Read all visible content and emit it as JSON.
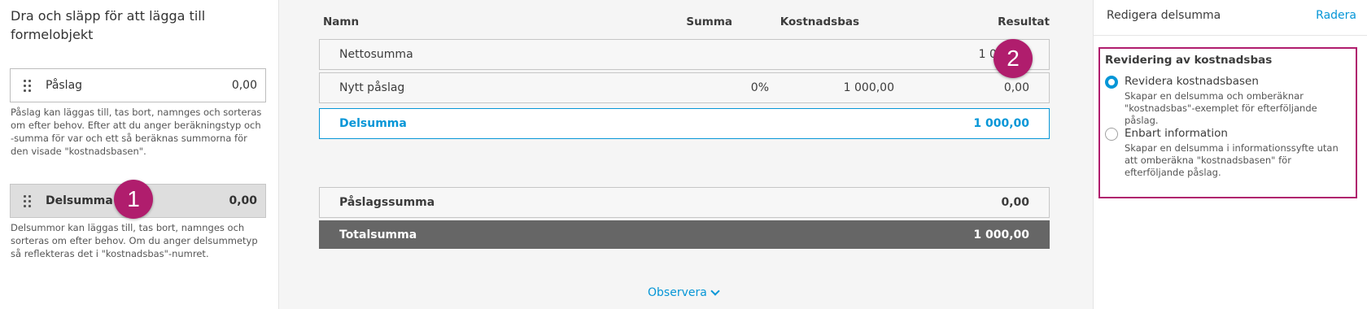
{
  "palette": {
    "title": "Dra och släpp för att lägga till formelobjekt",
    "items": [
      {
        "label": "Påslag",
        "value": "0,00",
        "help": "Påslag kan läggas till, tas bort, namnges och sorteras om efter behov. Efter att du anger beräkningstyp och -summa för var och ett så beräknas summorna för den visade \"kostnadsbasen\"."
      },
      {
        "label": "Delsumma",
        "value": "0,00",
        "help": "Delsummor kan läggas till, tas bort, namnges och sorteras om efter behov. Om du anger delsummetyp så reflekteras det i \"kostnadsbas\"-numret."
      }
    ]
  },
  "badges": {
    "one": "1",
    "two": "2"
  },
  "table": {
    "headers": {
      "name": "Namn",
      "sum": "Summa",
      "base": "Kostnadsbas",
      "result": "Resultat"
    },
    "rows": [
      {
        "name": "Nettosumma",
        "sum": "",
        "base": "",
        "result": "1 000,00"
      },
      {
        "name": "Nytt påslag",
        "sum": "0%",
        "base": "1 000,00",
        "result": "0,00"
      },
      {
        "name": "Delsumma",
        "sum": "",
        "base": "",
        "result": "1 000,00"
      }
    ],
    "markup_total": {
      "name": "Påslagssumma",
      "result": "0,00"
    },
    "grand_total": {
      "name": "Totalsumma",
      "result": "1 000,00"
    },
    "observe_label": "Observera"
  },
  "panel": {
    "title": "Redigera delsumma",
    "delete_label": "Radera",
    "section_title": "Revidering av kostnadsbas",
    "options": [
      {
        "label": "Revidera kostnadsbasen",
        "desc": "Skapar en delsumma och omberäknar \"kostnadsbas\"-exemplet för efterföljande påslag.",
        "selected": true
      },
      {
        "label": "Enbart information",
        "desc": "Skapar en delsumma i informationssyfte utan att omberäkna \"kostnadsbasen\" för efterföljande påslag.",
        "selected": false
      }
    ]
  },
  "colors": {
    "accent": "#0696d7",
    "callout": "#b01d6d",
    "total_bg": "#666666"
  }
}
